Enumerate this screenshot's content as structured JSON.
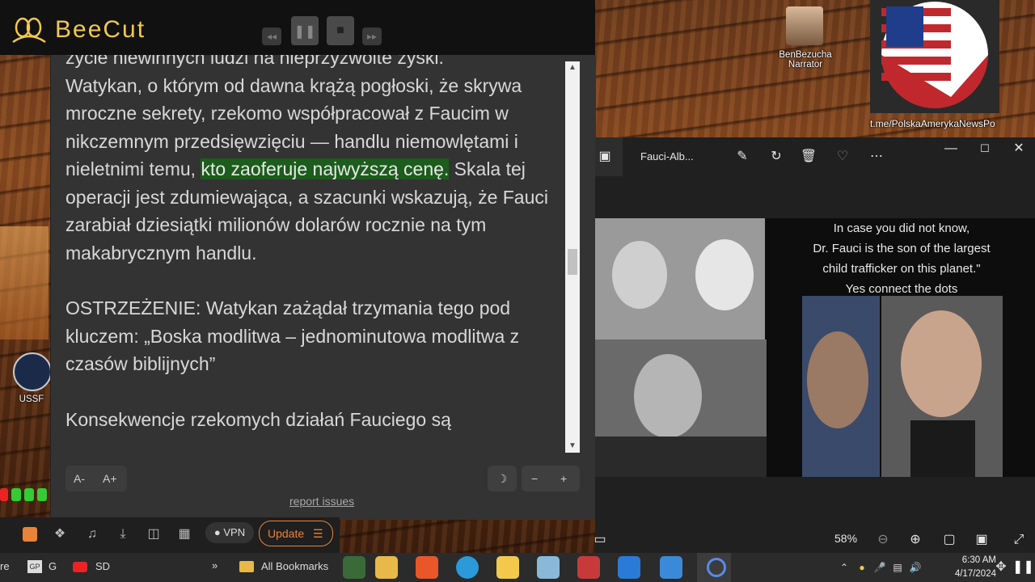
{
  "beecut": {
    "title": "BeeCut"
  },
  "reader": {
    "cut_top_line": "życie niewinnych ludzi na nieprzyzwoite zyski.",
    "para1_part1": "Watykan, o którym od dawna krążą pogłoski, że skrywa mroczne sekrety, rzekomo współpracował z Faucim w nikczemnym przedsięwzięciu — handlu niemowlętami i nieletnimi temu, ",
    "para1_highlight": "kto zaoferuje najwyższą cenę.",
    "para1_part2": " Skala tej operacji jest zdumiewająca, a szacunki wskazują, że Fauci zarabiał dziesiątki milionów dolarów rocznie na tym makabrycznym handlu.",
    "para2": "OSTRZEŻENIE: Watykan zażądał trzymania tego pod kluczem: „Boska modlitwa – jednominutowa modlitwa z czasów biblijnych”",
    "para3_cut": "Konsekwencje rzekomych działań Fauciego są",
    "font_decrease": "A-",
    "font_increase": "A+",
    "theme_icon": "moon-icon",
    "zoom_minus": "−",
    "zoom_plus": "+",
    "report_link": "report issues"
  },
  "desktop": {
    "narrator_label_line1": "BenBezucha",
    "narrator_label_line2": "Narrator",
    "ussf_label": "USSF",
    "channel_link": "t.me/PolskaAmerykaNewsPo"
  },
  "viewer": {
    "file_name": "Fauci-Alb...",
    "caption_line1": "In case you did not know,",
    "caption_line2": "Dr. Fauci is the son of the largest",
    "caption_line3": "child trafficker on this planet.\"",
    "caption_line4": "Yes connect the dots",
    "zoom_level": "58%"
  },
  "browser": {
    "vpn_label": "VPN",
    "update_label": "Update",
    "bookmarks": [
      {
        "label": "re"
      },
      {
        "label": "G"
      },
      {
        "label": "SD"
      }
    ],
    "all_bookmarks": "All Bookmarks"
  },
  "taskbar": {
    "time": "6:30 AM",
    "date": "4/17/2024"
  },
  "colors": {
    "highlight": "#1c5c1c",
    "brand": "#f2c94c",
    "update": "#e8833a"
  }
}
